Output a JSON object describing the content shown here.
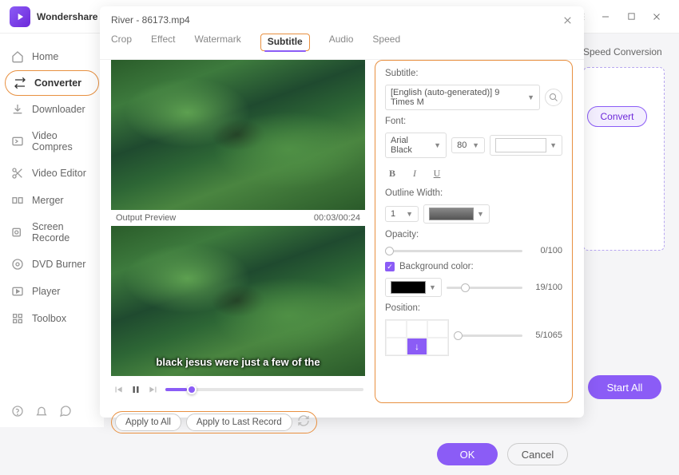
{
  "brand": "Wondershare",
  "sidebar": {
    "items": [
      {
        "label": "Home"
      },
      {
        "label": "Converter"
      },
      {
        "label": "Downloader"
      },
      {
        "label": "Video Compres"
      },
      {
        "label": "Video Editor"
      },
      {
        "label": "Merger"
      },
      {
        "label": "Screen Recorde"
      },
      {
        "label": "DVD Burner"
      },
      {
        "label": "Player"
      },
      {
        "label": "Toolbox"
      }
    ]
  },
  "header": {
    "speedConversion": "Speed Conversion"
  },
  "mainActions": {
    "convert": "Convert",
    "startAll": "Start All"
  },
  "dialog": {
    "title": "River - 86173.mp4",
    "tabs": [
      "Crop",
      "Effect",
      "Watermark",
      "Subtitle",
      "Audio",
      "Speed"
    ],
    "previewLabel": "Output Preview",
    "timecode": "00:03/00:24",
    "subtitleSample": "black jesus were just a few of the",
    "panel": {
      "subtitleLabel": "Subtitle:",
      "subtitleValue": "[English (auto-generated)] 9 Times M",
      "fontLabel": "Font:",
      "fontName": "Arial Black",
      "fontSize": "80",
      "outlineLabel": "Outline Width:",
      "outlineValue": "1",
      "opacityLabel": "Opacity:",
      "opacityValue": "0/100",
      "bgColorLabel": "Background color:",
      "bgColorValue": "19/100",
      "positionLabel": "Position:",
      "positionValue": "5/1065"
    },
    "actions": {
      "applyAll": "Apply to All",
      "applyLast": "Apply to Last Record",
      "ok": "OK",
      "cancel": "Cancel"
    }
  }
}
